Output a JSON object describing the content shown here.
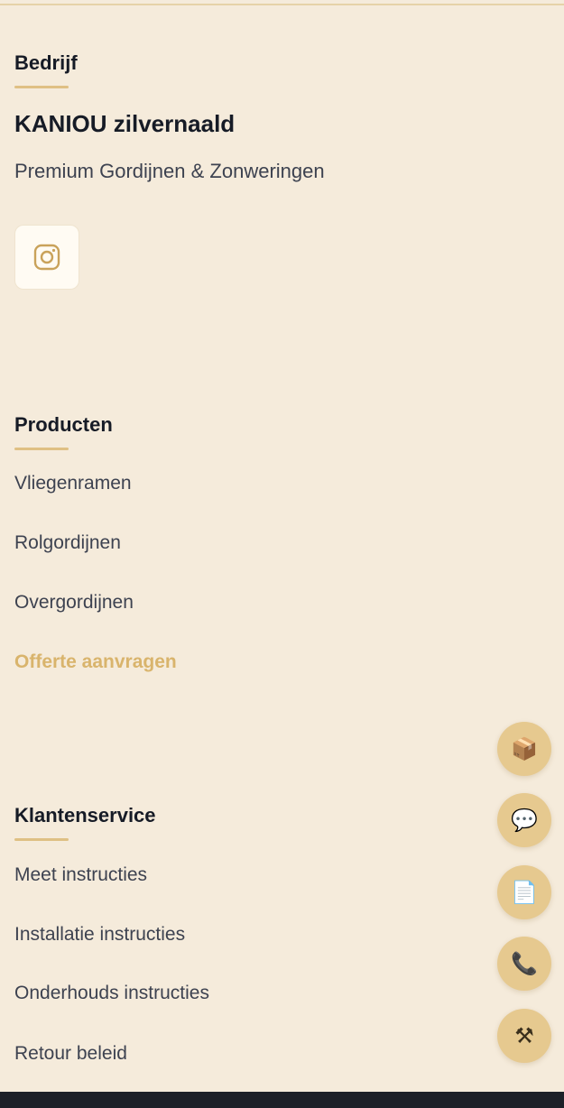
{
  "company": {
    "heading": "Bedrijf",
    "name": "KANIOU zilvernaald",
    "tagline": "Premium Gordijnen & Zonweringen",
    "social_icon": "instagram-icon"
  },
  "products": {
    "heading": "Producten",
    "items": [
      "Vliegenramen",
      "Rolgordijnen",
      "Overgordijnen"
    ],
    "cta": "Offerte aanvragen"
  },
  "service": {
    "heading": "Klantenservice",
    "items": [
      "Meet instructies",
      "Installatie instructies",
      "Onderhouds instructies",
      "Retour beleid"
    ]
  },
  "floating_actions": [
    {
      "icon": "package-icon",
      "glyph": "📦"
    },
    {
      "icon": "chat-icon",
      "glyph": "💬"
    },
    {
      "icon": "document-icon",
      "glyph": "📄"
    },
    {
      "icon": "phone-icon",
      "glyph": "📞"
    },
    {
      "icon": "tools-icon",
      "glyph": "⚒"
    }
  ],
  "colors": {
    "background": "#f5ebdb",
    "accent": "#d9b46c",
    "fab": "#e6c98f",
    "footer_bar": "#1d2028"
  }
}
